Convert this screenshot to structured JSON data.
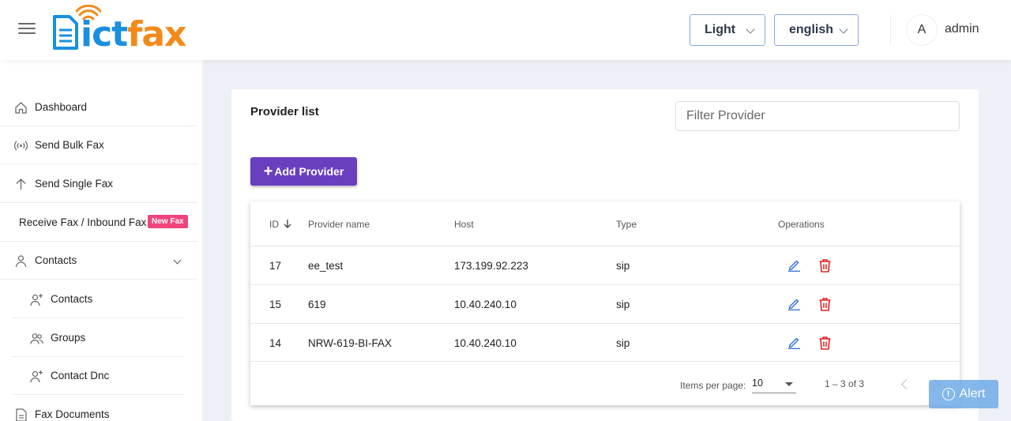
{
  "header": {
    "logo": {
      "part1": "ict",
      "part2": "fax"
    },
    "theme_select": "Light",
    "language_select": "english",
    "avatar_initial": "A",
    "username": "admin"
  },
  "sidebar": {
    "items": [
      {
        "label": "Dashboard",
        "icon": "home-icon"
      },
      {
        "label": "Send Bulk Fax",
        "icon": "broadcast-icon"
      },
      {
        "label": "Send Single Fax",
        "icon": "arrow-up-icon"
      },
      {
        "label": "Receive Fax / Inbound Fax",
        "badge": "New Fax"
      },
      {
        "label": "Contacts",
        "icon": "person-icon"
      },
      {
        "label": "Contacts",
        "icon": "person-add-icon"
      },
      {
        "label": "Groups",
        "icon": "people-icon"
      },
      {
        "label": "Contact Dnc",
        "icon": "person-add-icon"
      },
      {
        "label": "Fax Documents",
        "icon": "document-icon"
      }
    ]
  },
  "main": {
    "title": "Provider list",
    "filter_placeholder": "Filter Provider",
    "add_button": "Add Provider",
    "table": {
      "columns": [
        "ID",
        "Provider name",
        "Host",
        "Type",
        "Operations"
      ],
      "rows": [
        {
          "id": "17",
          "name": "ee_test",
          "host": "173.199.92.223",
          "type": "sip"
        },
        {
          "id": "15",
          "name": "619",
          "host": "10.40.240.10",
          "type": "sip"
        },
        {
          "id": "14",
          "name": "NRW-619-BI-FAX",
          "host": "10.40.240.10",
          "type": "sip"
        }
      ]
    },
    "pagination": {
      "items_per_page_label": "Items per page:",
      "page_size": "10",
      "range": "1 – 3 of 3"
    }
  },
  "alert_button": "Alert",
  "colors": {
    "brand_blue": "#1a8fe0",
    "brand_orange": "#f28a1a",
    "primary_button": "#6a3fbf",
    "badge": "#f0447a",
    "edit_icon": "#2d6fd8",
    "delete_icon": "#e02020"
  }
}
